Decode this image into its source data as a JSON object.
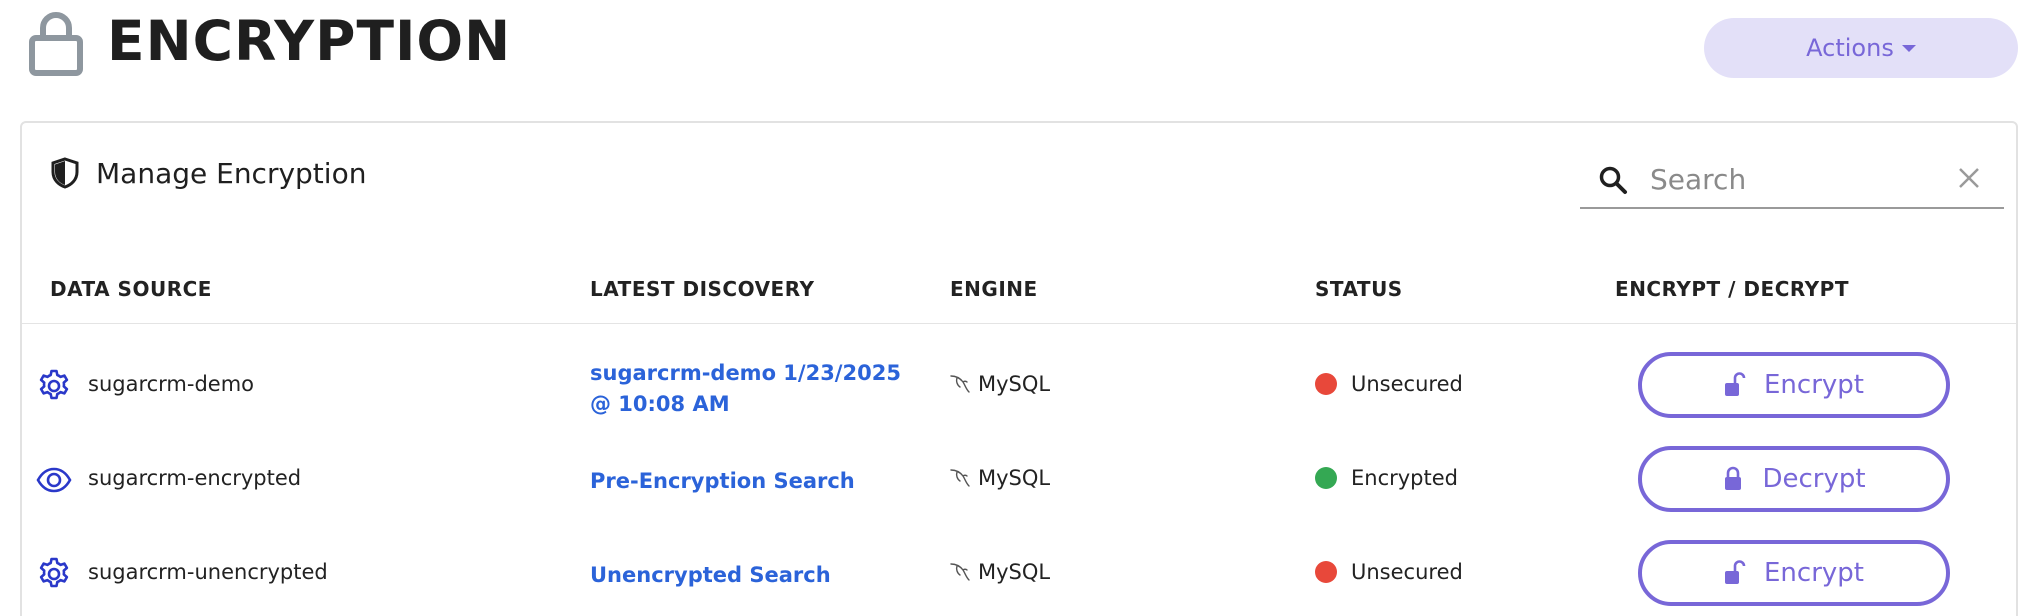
{
  "header": {
    "title": "ENCRYPTION",
    "actions_label": "Actions"
  },
  "card": {
    "title": "Manage Encryption",
    "search": {
      "placeholder": "Search",
      "value": ""
    }
  },
  "table": {
    "columns": [
      "DATA SOURCE",
      "LATEST DISCOVERY",
      "ENGINE",
      "STATUS",
      "ENCRYPT / DECRYPT"
    ],
    "rows": [
      {
        "data_source": "sugarcrm-demo",
        "icon": "gear-icon",
        "latest_discovery": "sugarcrm-demo 1/23/2025 @ 10:08 AM",
        "engine": "MySQL",
        "status": "Unsecured",
        "status_color": "#e8483a",
        "action": "Encrypt"
      },
      {
        "data_source": "sugarcrm-encrypted",
        "icon": "eye-icon",
        "latest_discovery": "Pre-Encryption Search",
        "engine": "MySQL",
        "status": "Encrypted",
        "status_color": "#34a853",
        "action": "Decrypt"
      },
      {
        "data_source": "sugarcrm-unencrypted",
        "icon": "gear-icon",
        "latest_discovery": "Unencrypted Search",
        "engine": "MySQL",
        "status": "Unsecured",
        "status_color": "#e8483a",
        "action": "Encrypt"
      }
    ]
  },
  "colors": {
    "accent": "#7867d8",
    "accent_light": "#e3e0f8",
    "link": "#2b63d9",
    "icon_blue": "#2a38c9"
  }
}
